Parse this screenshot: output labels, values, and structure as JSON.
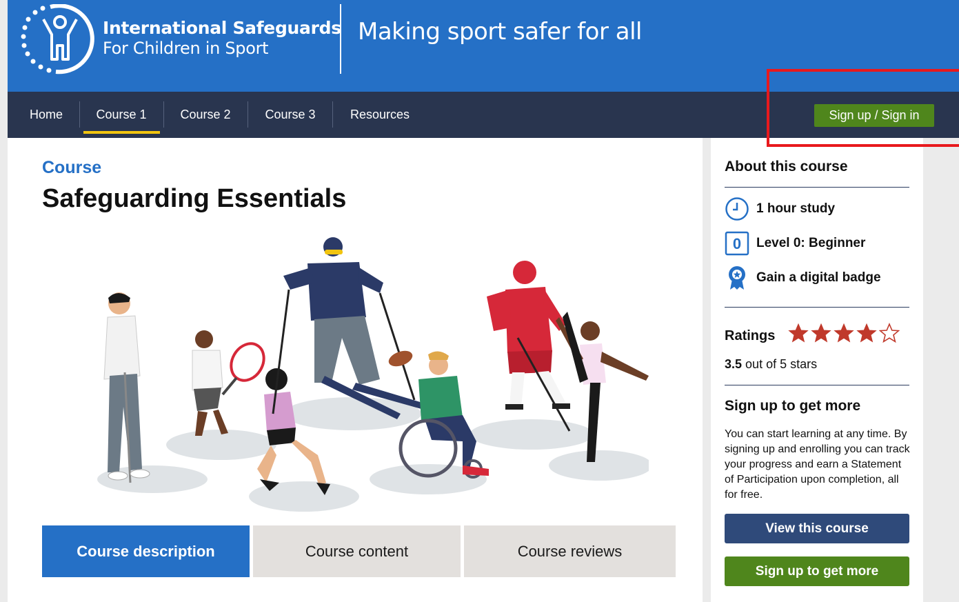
{
  "header": {
    "brand_line1": "International Safeguards",
    "brand_line2": "For Children in Sport",
    "tagline": "Making sport safer for all"
  },
  "nav": {
    "items": [
      {
        "label": "Home"
      },
      {
        "label": "Course 1",
        "active": true
      },
      {
        "label": "Course 2"
      },
      {
        "label": "Course 3"
      },
      {
        "label": "Resources"
      }
    ],
    "signin_label": "Sign up / Sign in"
  },
  "course": {
    "kicker": "Course",
    "title": "Safeguarding Essentials",
    "tabs": [
      {
        "label": "Course description",
        "active": true
      },
      {
        "label": "Course content"
      },
      {
        "label": "Course reviews"
      }
    ]
  },
  "sidebar": {
    "title": "About this course",
    "facts": [
      {
        "icon": "clock-icon",
        "label": "1 hour study"
      },
      {
        "icon": "level-icon",
        "label": "Level 0: Beginner",
        "icon_text": "0"
      },
      {
        "icon": "badge-icon",
        "label": "Gain a digital badge"
      }
    ],
    "ratings_label": "Ratings",
    "rating_value": "3.5",
    "rating_suffix": "out of 5 stars",
    "stars_filled": 4,
    "stars_total": 5,
    "signup_heading": "Sign up to get more",
    "signup_text": "You can start learning at any time. By signing up and enrolling you can track your progress and earn a Statement of Participation upon completion, all for free.",
    "view_button": "View this course",
    "signup_button": "Sign up to get more"
  },
  "colors": {
    "header_blue": "#2570c6",
    "nav_navy": "#29354f",
    "green": "#4f861c",
    "star_red": "#c0392b",
    "highlight_red": "#e8191d"
  }
}
